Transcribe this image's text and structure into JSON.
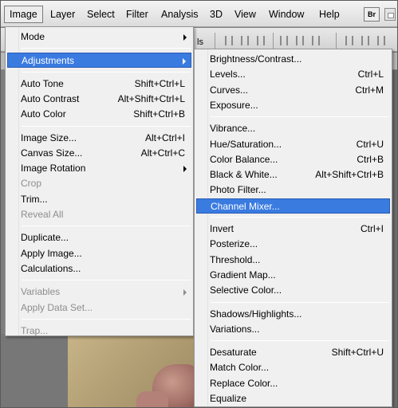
{
  "menubar": {
    "items": [
      "Image",
      "Layer",
      "Select",
      "Filter",
      "Analysis",
      "3D",
      "View",
      "Window",
      "Help"
    ],
    "bridge_label": "Br"
  },
  "optbar": {
    "partial_text": "ls"
  },
  "image_menu": {
    "groups": [
      [
        {
          "label": "Mode",
          "shortcut": "",
          "submenu": true,
          "disabled": false
        }
      ],
      [
        {
          "label": "Adjustments",
          "shortcut": "",
          "submenu": true,
          "disabled": false,
          "highlighted": true
        }
      ],
      [
        {
          "label": "Auto Tone",
          "shortcut": "Shift+Ctrl+L"
        },
        {
          "label": "Auto Contrast",
          "shortcut": "Alt+Shift+Ctrl+L"
        },
        {
          "label": "Auto Color",
          "shortcut": "Shift+Ctrl+B"
        }
      ],
      [
        {
          "label": "Image Size...",
          "shortcut": "Alt+Ctrl+I"
        },
        {
          "label": "Canvas Size...",
          "shortcut": "Alt+Ctrl+C"
        },
        {
          "label": "Image Rotation",
          "shortcut": "",
          "submenu": true
        },
        {
          "label": "Crop",
          "shortcut": "",
          "disabled": true
        },
        {
          "label": "Trim...",
          "shortcut": ""
        },
        {
          "label": "Reveal All",
          "shortcut": "",
          "disabled": true
        }
      ],
      [
        {
          "label": "Duplicate...",
          "shortcut": ""
        },
        {
          "label": "Apply Image...",
          "shortcut": ""
        },
        {
          "label": "Calculations...",
          "shortcut": ""
        }
      ],
      [
        {
          "label": "Variables",
          "shortcut": "",
          "submenu": true,
          "disabled": true
        },
        {
          "label": "Apply Data Set...",
          "shortcut": "",
          "disabled": true
        }
      ],
      [
        {
          "label": "Trap...",
          "shortcut": "",
          "disabled": true
        }
      ]
    ]
  },
  "adjustments_menu": {
    "groups": [
      [
        {
          "label": "Brightness/Contrast...",
          "shortcut": ""
        },
        {
          "label": "Levels...",
          "shortcut": "Ctrl+L"
        },
        {
          "label": "Curves...",
          "shortcut": "Ctrl+M"
        },
        {
          "label": "Exposure...",
          "shortcut": ""
        }
      ],
      [
        {
          "label": "Vibrance...",
          "shortcut": ""
        },
        {
          "label": "Hue/Saturation...",
          "shortcut": "Ctrl+U"
        },
        {
          "label": "Color Balance...",
          "shortcut": "Ctrl+B"
        },
        {
          "label": "Black & White...",
          "shortcut": "Alt+Shift+Ctrl+B"
        },
        {
          "label": "Photo Filter...",
          "shortcut": ""
        },
        {
          "label": "Channel Mixer...",
          "shortcut": "",
          "highlighted": true
        }
      ],
      [
        {
          "label": "Invert",
          "shortcut": "Ctrl+I"
        },
        {
          "label": "Posterize...",
          "shortcut": ""
        },
        {
          "label": "Threshold...",
          "shortcut": ""
        },
        {
          "label": "Gradient Map...",
          "shortcut": ""
        },
        {
          "label": "Selective Color...",
          "shortcut": ""
        }
      ],
      [
        {
          "label": "Shadows/Highlights...",
          "shortcut": ""
        },
        {
          "label": "Variations...",
          "shortcut": ""
        }
      ],
      [
        {
          "label": "Desaturate",
          "shortcut": "Shift+Ctrl+U"
        },
        {
          "label": "Match Color...",
          "shortcut": ""
        },
        {
          "label": "Replace Color...",
          "shortcut": ""
        },
        {
          "label": "Equalize",
          "shortcut": ""
        }
      ]
    ]
  },
  "colors": {
    "highlight": "#3a7be0",
    "disabled_text": "#8d8d8d"
  }
}
